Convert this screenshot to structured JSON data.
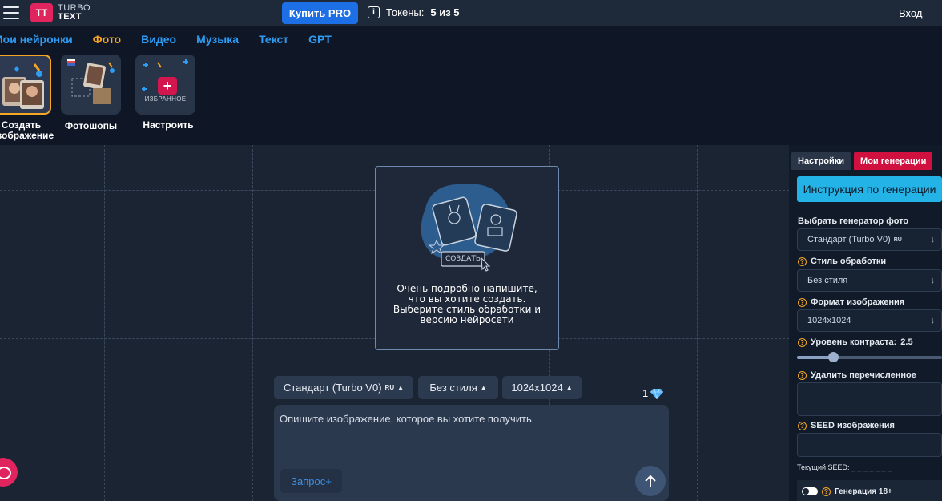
{
  "topbar": {
    "logo_box": "TT",
    "logo_line1": "TURBO",
    "logo_line2": "TEXT",
    "buy_pro": "Купить PRO",
    "tokens_label": "Токены:",
    "tokens_value": "5 из 5",
    "login": "Вход"
  },
  "tabs": [
    {
      "label": "Мои нейронки",
      "active": false
    },
    {
      "label": "Фото",
      "active": true
    },
    {
      "label": "Видео",
      "active": false
    },
    {
      "label": "Музыка",
      "active": false
    },
    {
      "label": "Текст",
      "active": false
    },
    {
      "label": "GPT",
      "active": false
    }
  ],
  "cards": {
    "create_line1": "Создать",
    "create_line2": "изображение",
    "photoshops": "Фотошопы",
    "customize": "Настроить",
    "favorites_badge": "ИЗБРАННОЕ"
  },
  "preview": {
    "button": "СОЗДАТЬ",
    "hint": "Очень подробно напишите, что вы хотите создать. Выберите стиль обработки и версию нейросети"
  },
  "controls": {
    "generator": "Стандарт (Turbo V0)",
    "generator_tag": "RU",
    "style": "Без стиля",
    "size": "1024x1024",
    "gem_count": "1"
  },
  "prompt": {
    "placeholder": "Опишите изображение, которое вы хотите получить",
    "zapros": "Запрос+"
  },
  "panel": {
    "tab_settings": "Настройки",
    "tab_mine": "Мои генерации",
    "instruction": "Инструкция по генерации",
    "gen_label": "Выбрать генератор фото",
    "gen_value": "Стандарт (Turbo V0)",
    "gen_tag": "RU",
    "style_label": "Стиль обработки",
    "style_value": "Без стиля",
    "format_label": "Формат изображения",
    "format_value": "1024x1024",
    "contrast_label": "Уровень контраста:",
    "contrast_value": "2.5",
    "contrast_fraction": 0.25,
    "remove_label": "Удалить перечисленное",
    "seed_label": "SEED изображения",
    "current_seed": "Текущий SEED: _ _ _ _ _ _ _",
    "gen18_label": "Генерация 18+"
  },
  "colors": {
    "accent_orange": "#f5a623",
    "brand_pink": "#e0245e",
    "link_blue": "#2f9cf4",
    "instruction_cyan": "#23b3e6"
  }
}
